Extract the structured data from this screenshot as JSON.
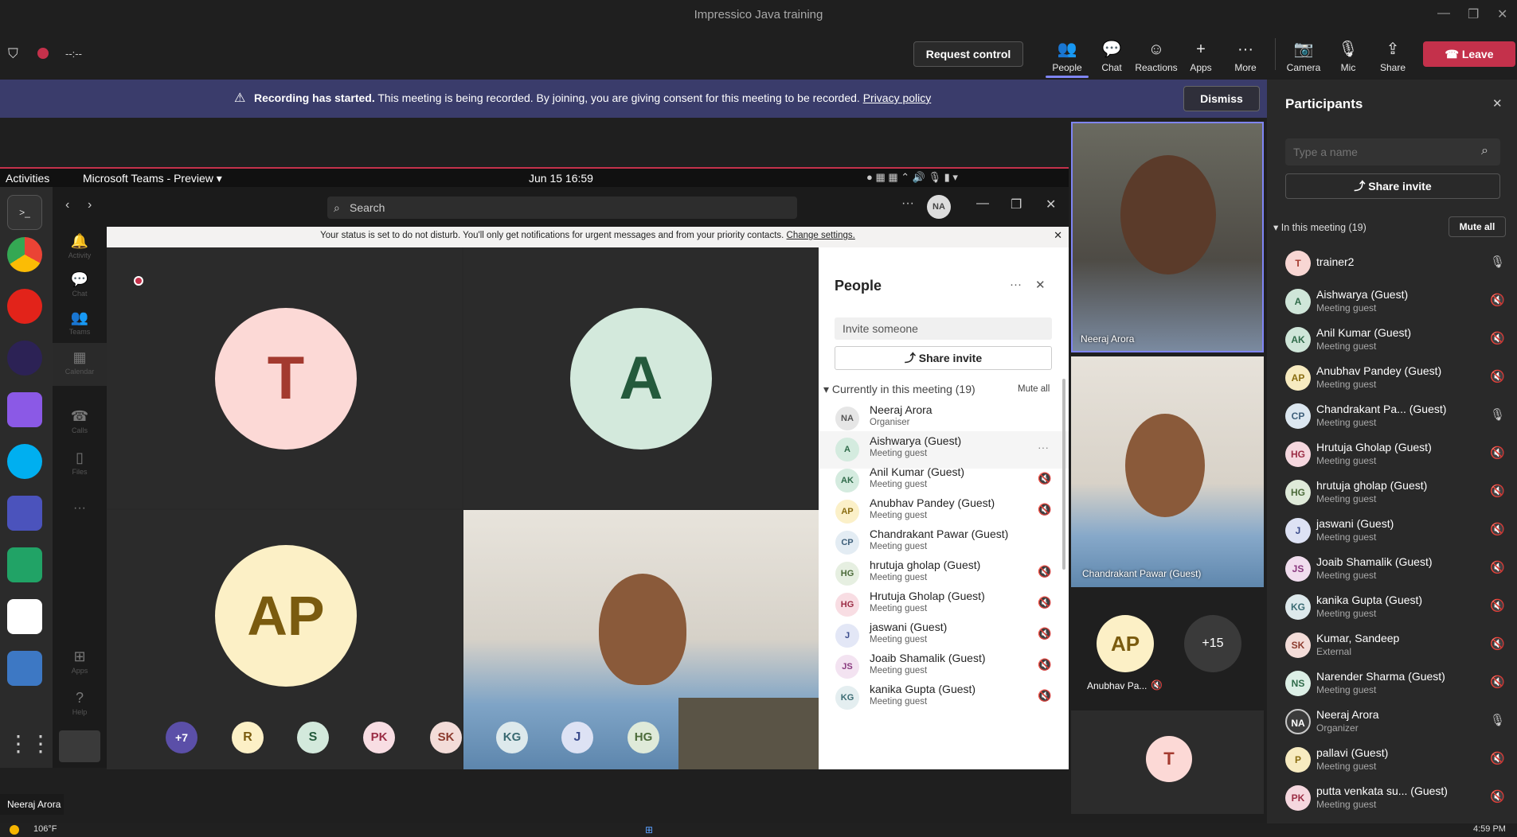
{
  "window": {
    "title": "Impressico Java training"
  },
  "toolbar": {
    "timer": "--:--",
    "request_control": "Request control",
    "buttons": [
      {
        "label": "People",
        "icon": "people-icon"
      },
      {
        "label": "Chat",
        "icon": "chat-icon"
      },
      {
        "label": "Reactions",
        "icon": "reactions-icon"
      },
      {
        "label": "Apps",
        "icon": "apps-icon"
      },
      {
        "label": "More",
        "icon": "more-icon"
      },
      {
        "label": "Camera",
        "icon": "camera-off-icon"
      },
      {
        "label": "Mic",
        "icon": "mic-icon"
      },
      {
        "label": "Share",
        "icon": "share-icon"
      }
    ],
    "leave": "Leave"
  },
  "banner": {
    "bold": "Recording has started.",
    "text": "This meeting is being recorded. By joining, you are giving consent for this meeting to be recorded.",
    "link": "Privacy policy",
    "dismiss": "Dismiss"
  },
  "shared": {
    "ubuntu": {
      "activities": "Activities",
      "app": "Microsoft Teams - Preview",
      "clock": "Jun 15  16:59"
    },
    "teams": {
      "search": "Search",
      "avatar": "NA",
      "rail": [
        "Activity",
        "Chat",
        "Teams",
        "Calendar",
        "Calls",
        "Files",
        "Apps",
        "Help"
      ],
      "dnd": "Your status is set to do not disturb. You'll only get notifications for urgent messages and from your priority contacts.",
      "dnd_link": "Change settings.",
      "tiles": {
        "t": "T",
        "a": "A",
        "ap": "AP"
      },
      "bottom_avatars": [
        "+7",
        "R",
        "S",
        "PK",
        "SK",
        "KG",
        "J",
        "HG"
      ],
      "people": {
        "title": "People",
        "invite": "Invite someone",
        "share_invite": "Share invite",
        "section": "Currently in this meeting  (19)",
        "mute_all": "Mute all",
        "rows": [
          {
            "initials": "NA",
            "name": "Neeraj Arora",
            "role": "Organiser",
            "color": "#e6e6e6",
            "fg": "#555"
          },
          {
            "initials": "A",
            "name": "Aishwarya (Guest)",
            "role": "Meeting guest",
            "color": "#d4ebdf",
            "fg": "#2f6b4a"
          },
          {
            "initials": "AK",
            "name": "Anil Kumar (Guest)",
            "role": "Meeting guest",
            "color": "#d4ebdf",
            "fg": "#2f6b4a"
          },
          {
            "initials": "AP",
            "name": "Anubhav Pandey (Guest)",
            "role": "Meeting guest",
            "color": "#fbf0c8",
            "fg": "#8a6d12"
          },
          {
            "initials": "CP",
            "name": "Chandrakant Pawar (Guest)",
            "role": "Meeting guest",
            "color": "#e3ecf3",
            "fg": "#3e5f7a"
          },
          {
            "initials": "HG",
            "name": "hrutuja gholap (Guest)",
            "role": "Meeting guest",
            "color": "#e6efe1",
            "fg": "#4c6b3a"
          },
          {
            "initials": "HG",
            "name": "Hrutuja Gholap (Guest)",
            "role": "Meeting guest",
            "color": "#f8dde3",
            "fg": "#9b2d45"
          },
          {
            "initials": "J",
            "name": "jaswani (Guest)",
            "role": "Meeting guest",
            "color": "#e3e7f6",
            "fg": "#3b4c8c"
          },
          {
            "initials": "JS",
            "name": "Joaib Shamalik (Guest)",
            "role": "Meeting guest",
            "color": "#f3e3f1",
            "fg": "#8a3a7f"
          },
          {
            "initials": "KG",
            "name": "kanika Gupta (Guest)",
            "role": "Meeting guest",
            "color": "#e4eef0",
            "fg": "#3a6a72"
          }
        ]
      }
    }
  },
  "videos": {
    "v1": "Neeraj Arora",
    "v2": "Chandrakant Pawar (Guest)",
    "ap_initials": "AP",
    "ap_name": "Anubhav Pa...",
    "more": "+15",
    "t": "T"
  },
  "participants": {
    "title": "Participants",
    "search_placeholder": "Type a name",
    "share_invite": "Share invite",
    "section": "In this meeting (19)",
    "mute_all": "Mute all",
    "rows": [
      {
        "initials": "T",
        "name": "trainer2",
        "role": "",
        "color": "#f8d6d3",
        "fg": "#a33a2f",
        "mic": "on"
      },
      {
        "initials": "A",
        "name": "Aishwarya (Guest)",
        "role": "Meeting guest",
        "color": "#cfe6d9",
        "fg": "#2f6b4a",
        "mic": "off"
      },
      {
        "initials": "AK",
        "name": "Anil Kumar (Guest)",
        "role": "Meeting guest",
        "color": "#cfe6d9",
        "fg": "#2f6b4a",
        "mic": "off"
      },
      {
        "initials": "AP",
        "name": "Anubhav Pandey (Guest)",
        "role": "Meeting guest",
        "color": "#f7ebc0",
        "fg": "#8a6d12",
        "mic": "off"
      },
      {
        "initials": "CP",
        "name": "Chandrakant Pa...   (Guest)",
        "role": "Meeting guest",
        "color": "#dce7f0",
        "fg": "#3e5f7a",
        "mic": "on"
      },
      {
        "initials": "HG",
        "name": "Hrutuja Gholap (Guest)",
        "role": "Meeting guest",
        "color": "#f5d7de",
        "fg": "#9b2d45",
        "mic": "off"
      },
      {
        "initials": "HG",
        "name": "hrutuja gholap (Guest)",
        "role": "Meeting guest",
        "color": "#dfead9",
        "fg": "#4c6b3a",
        "mic": "off"
      },
      {
        "initials": "J",
        "name": "jaswani (Guest)",
        "role": "Meeting guest",
        "color": "#dde2f4",
        "fg": "#3b4c8c",
        "mic": "off"
      },
      {
        "initials": "JS",
        "name": "Joaib Shamalik (Guest)",
        "role": "Meeting guest",
        "color": "#f1ddee",
        "fg": "#8a3a7f",
        "mic": "off"
      },
      {
        "initials": "KG",
        "name": "kanika Gupta (Guest)",
        "role": "Meeting guest",
        "color": "#dde9ec",
        "fg": "#3a6a72",
        "mic": "off"
      },
      {
        "initials": "SK",
        "name": "Kumar, Sandeep",
        "role": "External",
        "color": "#f3dcd8",
        "fg": "#8c3b2e",
        "mic": "off"
      },
      {
        "initials": "NS",
        "name": "Narender Sharma (Guest)",
        "role": "Meeting guest",
        "color": "#dcefe6",
        "fg": "#2f6b4a",
        "mic": "off"
      },
      {
        "initials": "NA",
        "name": "Neeraj Arora",
        "role": "Organizer",
        "color": "#3b3b3b",
        "fg": "#fff",
        "mic": "on"
      },
      {
        "initials": "P",
        "name": "pallavi (Guest)",
        "role": "Meeting guest",
        "color": "#f7ebc0",
        "fg": "#8a6d12",
        "mic": "off"
      },
      {
        "initials": "PK",
        "name": "putta venkata su...   (Guest)",
        "role": "Meeting guest",
        "color": "#f5d7de",
        "fg": "#9b2d45",
        "mic": "off"
      }
    ]
  },
  "footer": {
    "speaker": "Neeraj Arora",
    "temp": "106°F",
    "time": "4:59 PM"
  }
}
